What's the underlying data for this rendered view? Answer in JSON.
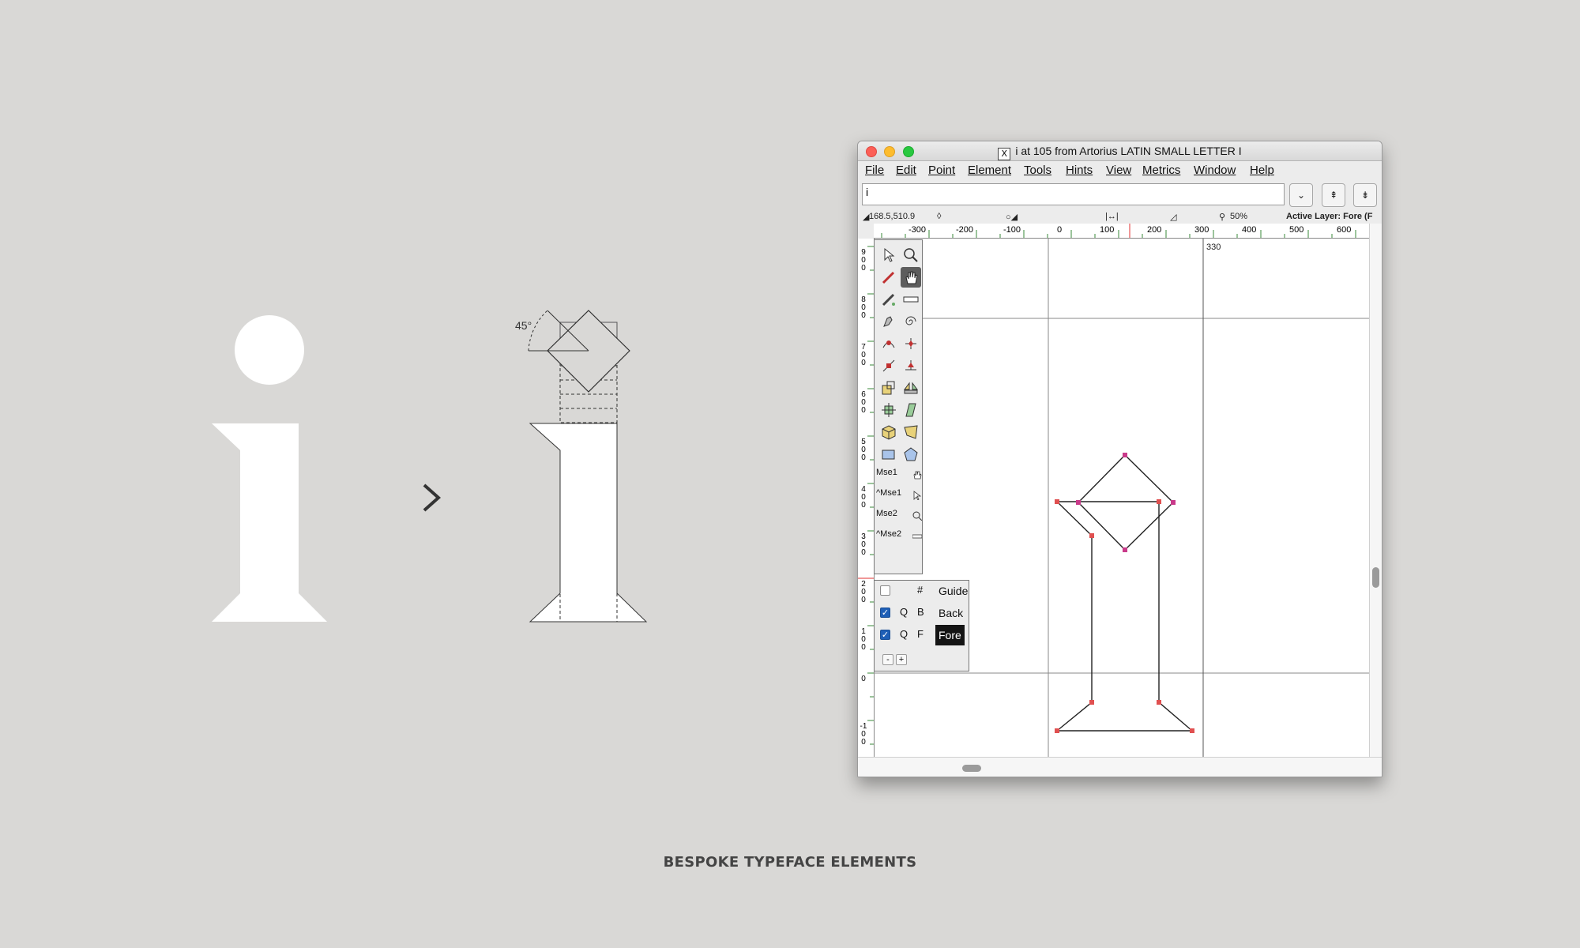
{
  "left_art": {
    "glyph": "i",
    "angle_label": "45°",
    "arrow": "chevron-right-icon"
  },
  "window": {
    "title": "i at 105 from Artorius LATIN SMALL LETTER I",
    "x11_badge": "X",
    "menu": [
      "File",
      "Edit",
      "Point",
      "Element",
      "Tools",
      "Hints",
      "View",
      "Metrics",
      "Window",
      "Help"
    ],
    "name_field_value": "i",
    "buttons": {
      "dropdown": "⌄",
      "up": "⇞",
      "down": "⇟"
    },
    "info": {
      "coords": "168.5,510.9",
      "zoom": "50%",
      "active_layer": "Active Layer: Fore (F"
    },
    "h_ruler_labels": [
      "-300",
      "-200",
      "-100",
      "0",
      "100",
      "200",
      "300",
      "400",
      "500",
      "600"
    ],
    "v_ruler_labels": [
      "900",
      "800",
      "700",
      "600",
      "500",
      "400",
      "300",
      "200",
      "100",
      "0",
      "-100"
    ],
    "width_label": "330",
    "mouse_bindings": [
      "Mse1",
      "^Mse1",
      "Mse2",
      "^Mse2"
    ],
    "layers": [
      {
        "checked": false,
        "q": "",
        "code": "#",
        "name": "Guide",
        "selected": false
      },
      {
        "checked": true,
        "q": "Q",
        "code": "B",
        "name": "Back",
        "selected": false
      },
      {
        "checked": true,
        "q": "Q",
        "code": "F",
        "name": "Fore",
        "selected": true
      }
    ],
    "layer_buttons": [
      "-",
      "+"
    ]
  },
  "caption": "BESPOKE TYPEFACE ELEMENTS"
}
